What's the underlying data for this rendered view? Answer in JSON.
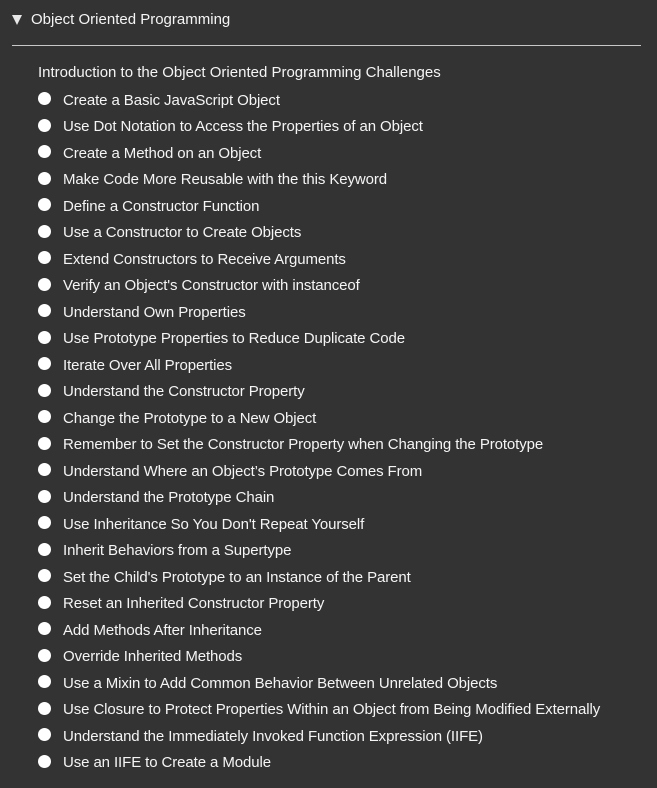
{
  "section": {
    "title": "Object Oriented Programming",
    "intro": "Introduction to the Object Oriented Programming Challenges",
    "challenges": [
      "Create a Basic JavaScript Object",
      "Use Dot Notation to Access the Properties of an Object",
      "Create a Method on an Object",
      "Make Code More Reusable with the this Keyword",
      "Define a Constructor Function",
      "Use a Constructor to Create Objects",
      "Extend Constructors to Receive Arguments",
      "Verify an Object's Constructor with instanceof",
      "Understand Own Properties",
      "Use Prototype Properties to Reduce Duplicate Code",
      "Iterate Over All Properties",
      "Understand the Constructor Property",
      "Change the Prototype to a New Object",
      "Remember to Set the Constructor Property when Changing the Prototype",
      "Understand Where an Object’s Prototype Comes From",
      "Understand the Prototype Chain",
      "Use Inheritance So You Don't Repeat Yourself",
      "Inherit Behaviors from a Supertype",
      "Set the Child's Prototype to an Instance of the Parent",
      "Reset an Inherited Constructor Property",
      "Add Methods After Inheritance",
      "Override Inherited Methods",
      "Use a Mixin to Add Common Behavior Between Unrelated Objects",
      "Use Closure to Protect Properties Within an Object from Being Modified Externally",
      "Understand the Immediately Invoked Function Expression (IIFE)",
      "Use an IIFE to Create a Module"
    ]
  },
  "icons": {
    "expand": "caret-down-icon",
    "status": "incomplete-dot-icon"
  },
  "colors": {
    "background": "#333333",
    "text": "#f5f5f5",
    "divider": "#c8c8c8",
    "dot": "#ffffff"
  }
}
